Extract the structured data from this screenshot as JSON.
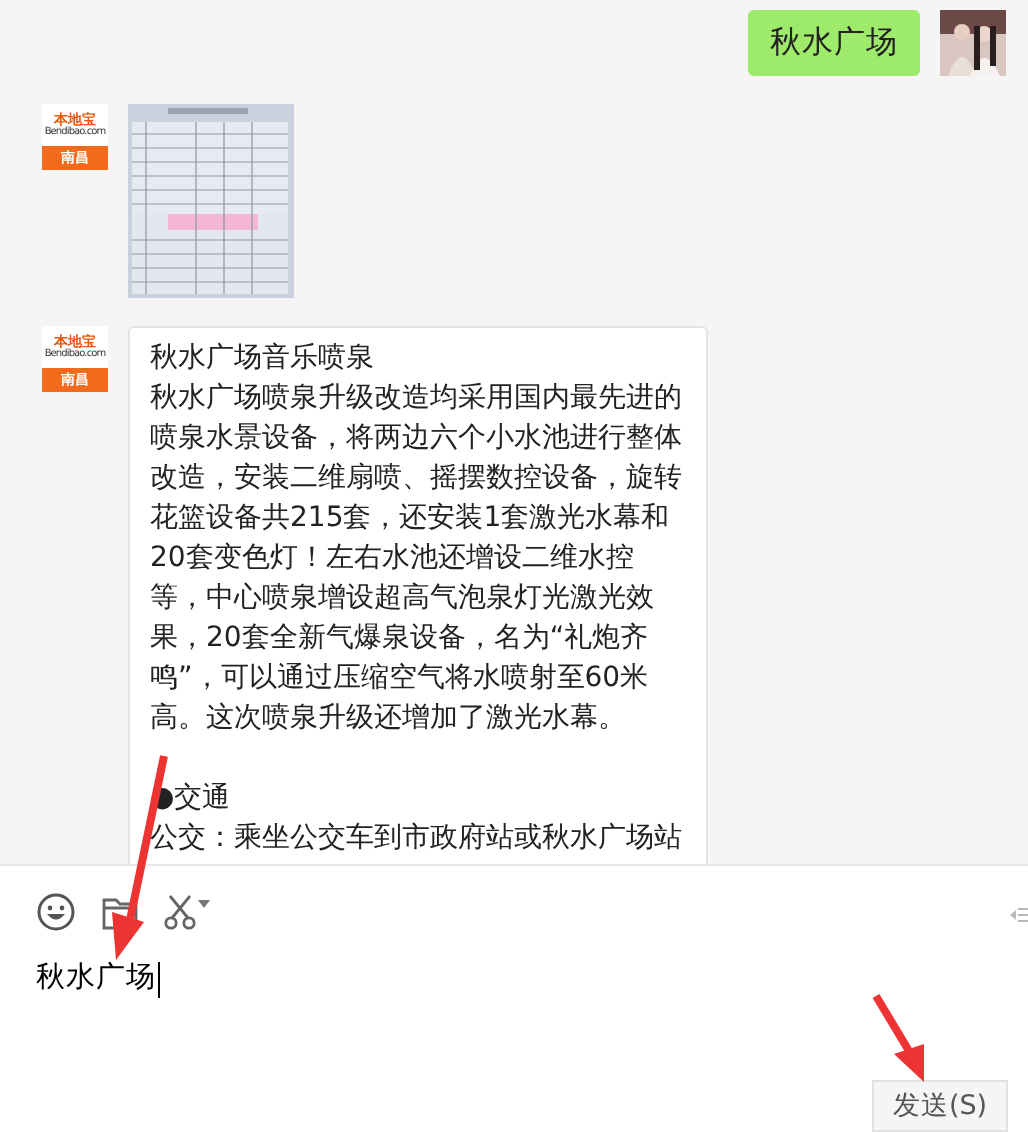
{
  "messages": [
    {
      "kind": "text",
      "outgoing": true,
      "paragraphs": [
        [
          "秋水广场"
        ]
      ]
    },
    {
      "outgoing": false,
      "avatar": {
        "brand": "本地宝",
        "site": "Bendibao.com",
        "city": "南昌"
      }
    },
    {
      "kind": "text",
      "outgoing": false,
      "avatar": {
        "brand": "本地宝",
        "site": "Bendibao.com",
        "city": "南昌"
      },
      "paragraphs": [
        [
          "秋水广场音乐喷泉",
          "秋水广场喷泉升级改造均采用国内最先进的喷泉水景设备，将两边六个小水池进行整体改造，安装二维扇喷、摇摆数控设备，旋转花篮设备共215套，还安装1套激光水幕和20套变色灯！左右水池还增设二维水控等，中心喷泉增设超高气泡泉灯光激光效果，20套全新气爆泉设备，名为“礼炮齐鸣”，可以通过压缩空气将水喷射至60米高。这次喷泉升级还增加了激光水幕。"
        ],
        [
          "●交通",
          "公交：乘坐公交车到市政府站或秋水广场站"
        ]
      ]
    }
  ],
  "composer": {
    "value": "秋水广场",
    "send_button": "发送(S)"
  }
}
